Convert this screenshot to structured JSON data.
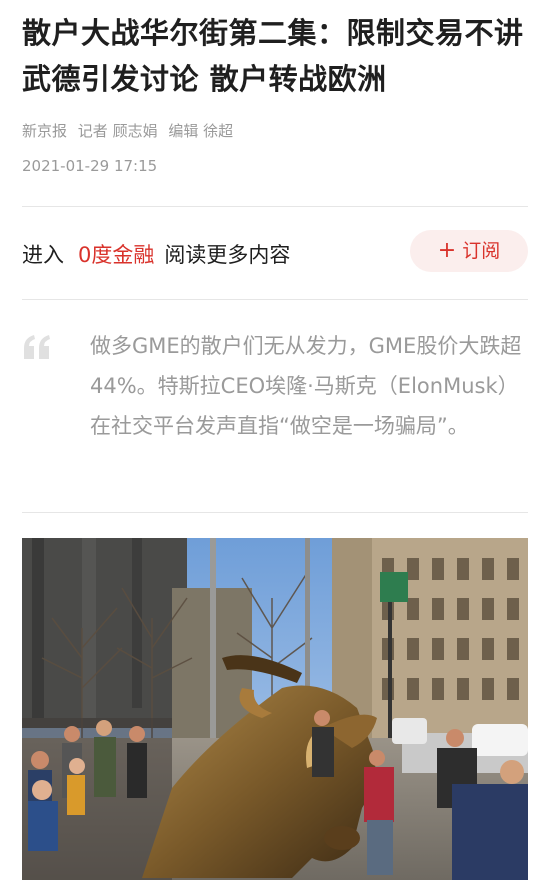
{
  "article": {
    "title": "散户大战华尔街第二集：限制交易不讲武德引发讨论 散户转战欧洲",
    "source": "新京报",
    "reporter": "记者 顾志娟",
    "editor": "编辑 徐超",
    "date": "2021-01-29 17:15",
    "quote": "做多GME的散户们无从发力，GME股价大跌超44%。特斯拉CEO埃隆·马斯克（ElonMusk）在社交平台发声直指“做空是一场骗局”。"
  },
  "cta": {
    "enter_label": "进入",
    "brand_label": "0度金融",
    "more_label": "阅读更多内容",
    "subscribe_label": "订阅"
  },
  "colors": {
    "accent": "#d9322b",
    "subscribe_bg": "#fbeeed",
    "muted_text": "#9a9a9a",
    "quote_mark": "#e0e0e0"
  },
  "icons": {
    "quote": "quote-icon",
    "subscribe_plus": "plus-icon"
  }
}
